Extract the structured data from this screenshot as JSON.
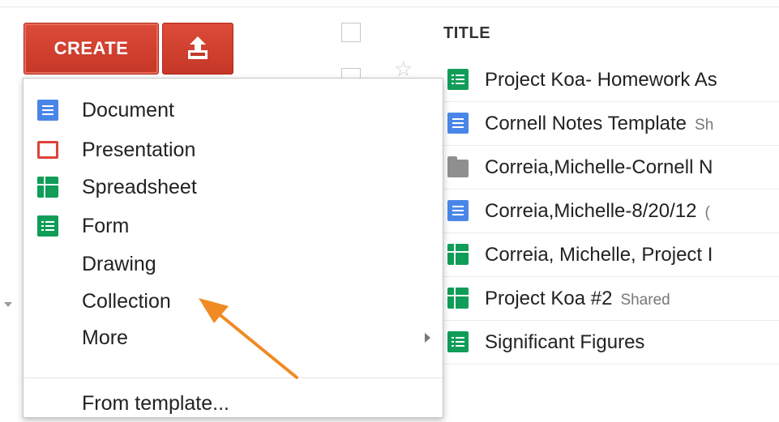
{
  "toolbar": {
    "create_label": "CREATE",
    "upload_icon": "upload-icon"
  },
  "create_menu": {
    "items": [
      {
        "label": "Document",
        "icon": "document-icon"
      },
      {
        "label": "Presentation",
        "icon": "presentation-icon"
      },
      {
        "label": "Spreadsheet",
        "icon": "spreadsheet-icon"
      },
      {
        "label": "Form",
        "icon": "form-icon"
      },
      {
        "label": "Drawing",
        "icon": ""
      },
      {
        "label": "Collection",
        "icon": ""
      },
      {
        "label": "More",
        "icon": "",
        "submenu": true
      }
    ],
    "template_label": "From template..."
  },
  "file_list": {
    "title_header": "TITLE",
    "rows": [
      {
        "name": "Project Koa- Homework As",
        "type": "form",
        "shared": ""
      },
      {
        "name": "Cornell Notes Template",
        "type": "document",
        "shared": "Sh"
      },
      {
        "name": "Correia,Michelle-Cornell N",
        "type": "folder",
        "shared": ""
      },
      {
        "name": "Correia,Michelle-8/20/12",
        "type": "document",
        "shared": "("
      },
      {
        "name": "Correia, Michelle, Project I",
        "type": "spreadsheet",
        "shared": ""
      },
      {
        "name": "Project Koa #2",
        "type": "spreadsheet",
        "shared": "Shared"
      },
      {
        "name": "Significant Figures",
        "type": "form",
        "shared": ""
      }
    ]
  },
  "colors": {
    "create_red": "#dd4b39",
    "doc_blue": "#4a86e8",
    "sheet_green": "#0f9d58",
    "pres_red": "#db4437",
    "arrow_orange": "#f08a24"
  }
}
